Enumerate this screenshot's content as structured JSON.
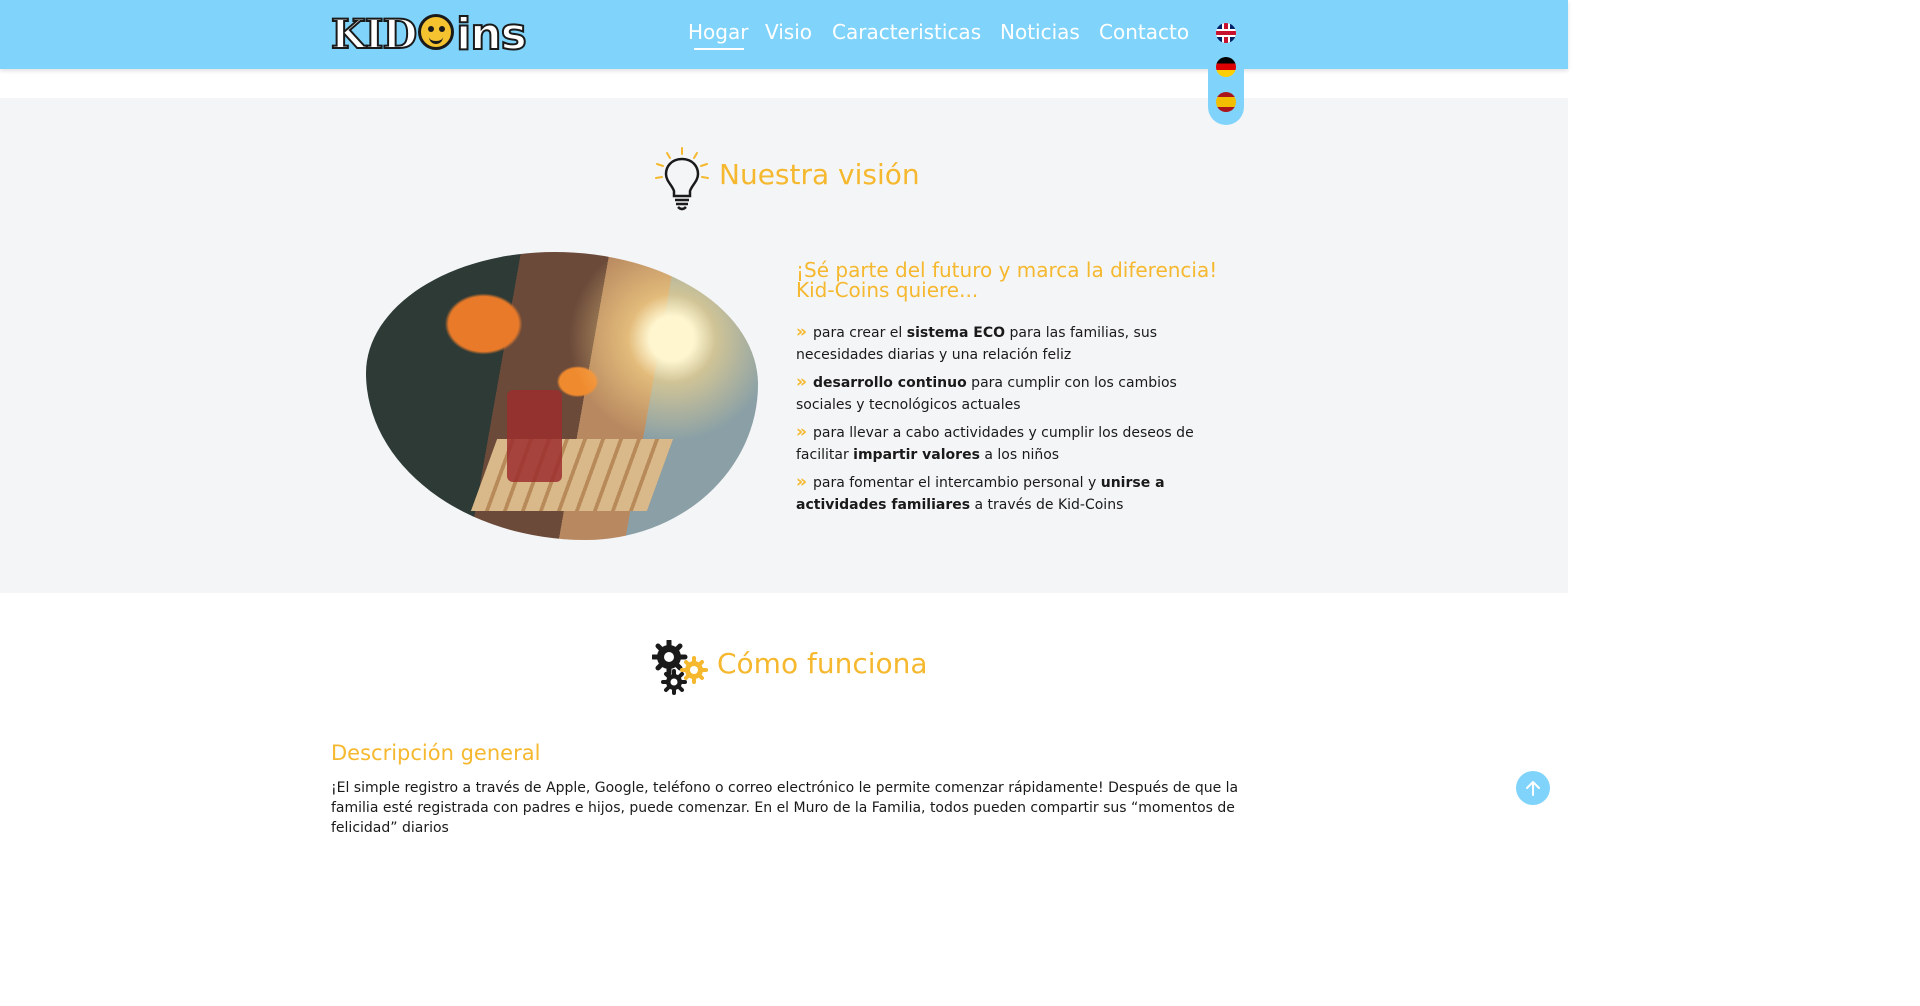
{
  "header": {
    "logo_text_kid": "KID",
    "logo_text_ins": "ins",
    "nav": [
      {
        "label": "Hogar",
        "active": true
      },
      {
        "label": "Visio",
        "active": false
      },
      {
        "label": "Caracteristicas",
        "active": false
      },
      {
        "label": "Noticias",
        "active": false
      },
      {
        "label": "Contacto",
        "active": false
      }
    ],
    "languages": [
      "uk-flag-icon",
      "germany-flag-icon",
      "spain-flag-icon"
    ]
  },
  "vision": {
    "title": "Nuestra visión",
    "subtitle": "¡Sé parte del futuro y marca la diferencia! Kid-Coins quiere...",
    "items": [
      {
        "pre": "para crear el ",
        "bold": "sistema ECO",
        "post": " para las familias, sus necesidades diarias y una relación feliz"
      },
      {
        "pre": "",
        "bold": "desarrollo continuo",
        "post": " para cumplir con los cambios sociales y tecnológicos actuales"
      },
      {
        "pre": "para llevar a cabo actividades y cumplir los deseos de facilitar ",
        "bold": "impartir valores",
        "post": " a los niños"
      },
      {
        "pre": "para fomentar el intercambio personal y ",
        "bold": "unirse a actividades familiares",
        "post": " a través de Kid-Coins"
      }
    ]
  },
  "how": {
    "title": "Cómo funciona",
    "desc_title": "Descripción general",
    "desc_text": "¡El simple registro a través de Apple, Google, teléfono o correo electrónico le permite comenzar rápidamente! Después de que la familia esté registrada con padres e hijos, puede comenzar. En el Muro de la Familia, todos pueden compartir sus “momentos de felicidad” diarios"
  },
  "colors": {
    "header_bg": "#80d4fb",
    "accent_yellow": "#f5b82e",
    "section_bg": "#f4f5f7"
  }
}
